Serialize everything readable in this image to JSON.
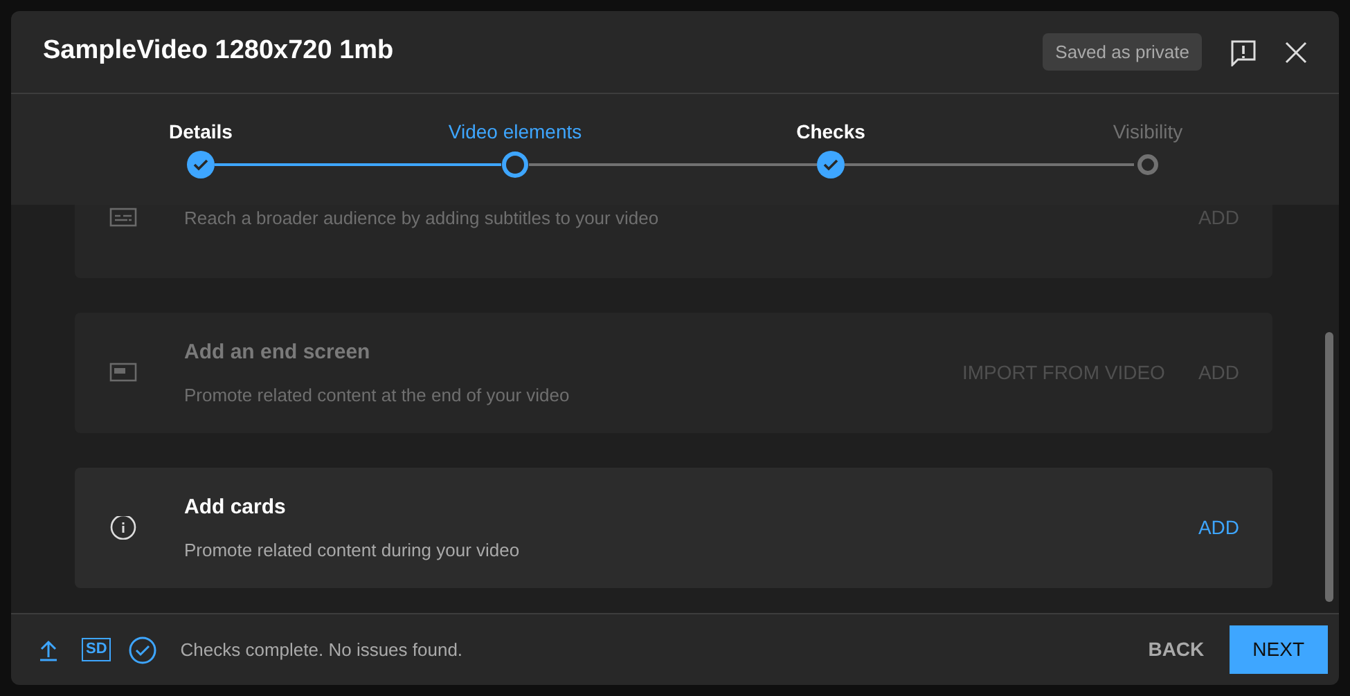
{
  "dialog": {
    "title": "SampleVideo 1280x720 1mb",
    "badge": "Saved as private"
  },
  "steps": [
    {
      "label": "Details",
      "kind": "done",
      "selected": false
    },
    {
      "label": "Video elements",
      "kind": "current",
      "selected": true
    },
    {
      "label": "Checks",
      "kind": "done",
      "selected": false
    },
    {
      "label": "Visibility",
      "kind": "pending",
      "selected": false
    }
  ],
  "elements": [
    {
      "kind": "subtitles",
      "description": "Reach a broader audience by adding subtitles to your video",
      "actions": [
        "ADD"
      ],
      "disabled": true
    },
    {
      "kind": "endscreen",
      "title": "Add an end screen",
      "description": "Promote related content at the end of your video",
      "actions": [
        "IMPORT FROM VIDEO",
        "ADD"
      ],
      "disabled": true
    },
    {
      "kind": "cards",
      "title": "Add cards",
      "description": "Promote related content during your video",
      "actions": [
        "ADD"
      ],
      "disabled": false
    }
  ],
  "footer": {
    "status": "Checks complete. No issues found.",
    "quality": "SD",
    "buttons": [
      "BACK",
      "NEXT"
    ]
  }
}
